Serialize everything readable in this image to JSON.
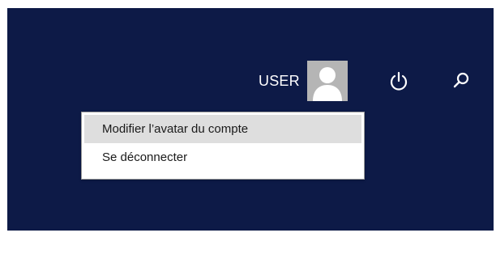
{
  "user": {
    "name": "USER",
    "avatar_icon": "user-avatar-icon"
  },
  "toolbar": {
    "power_icon": "power-icon",
    "search_icon": "search-icon"
  },
  "menu": {
    "items": [
      {
        "label": "Modifier l’avatar du compte",
        "highlighted": true
      },
      {
        "label": "Se déconnecter",
        "highlighted": false
      }
    ]
  },
  "colors": {
    "background": "#0d1a47",
    "menu_highlight": "#dedede",
    "avatar_bg": "#b5b5b5"
  }
}
